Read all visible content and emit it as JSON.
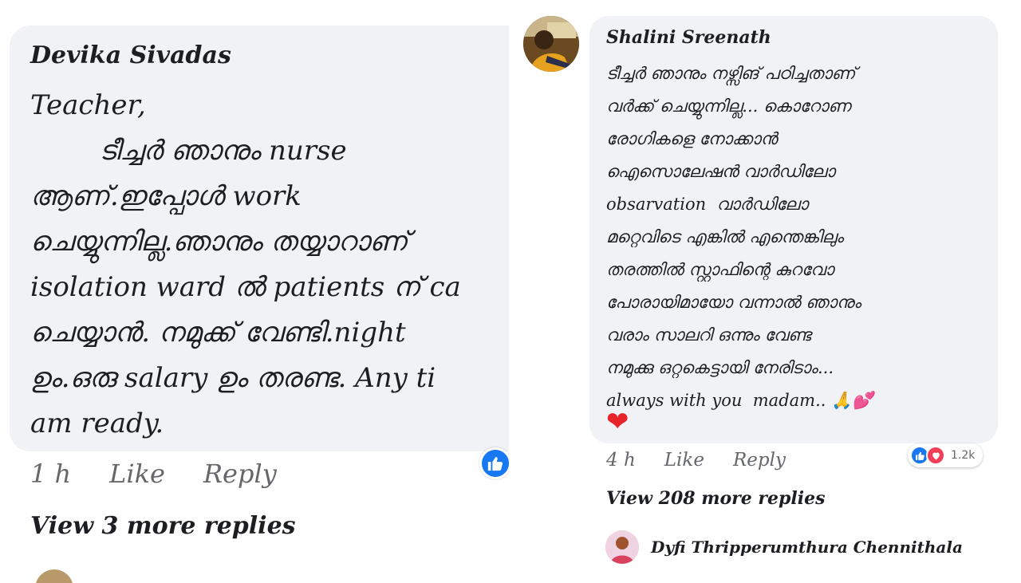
{
  "left_comment": {
    "author": "Devika Sivadas",
    "text": "Teacher,\n        ടീച്ചർ ഞാനും nurse\nആണ്.ഇപ്പോൾ work\nചെയ്യുന്നില്ല.ഞാനും തയ്യാറാണ്\nisolation ward ൽ patients ന് ca\nചെയ്യാൻ. നമുക്ക് വേണ്ടി.night\nഉം.ഒരു salary ഉം തരണ്ട. Any ti\nam ready.",
    "time": "1 h",
    "like_label": "Like",
    "reply_label": "Reply",
    "more_replies": "View 3 more replies",
    "reaction_icon": "like-icon"
  },
  "right_comment": {
    "author": "Shalini Sreenath",
    "text": "ടീച്ചർ ഞാനും നഴ്സിങ് പഠിച്ചതാണ്\nവർക്ക് ചെയ്യുന്നില്ല... കൊറോണ\nരോഗികളെ നോക്കാൻ\nഐസൊലേഷൻ വാർഡിലോ\nobsarvation  വാർഡിലോ\nമറ്റെവിടെ എങ്കിൽ എന്തെങ്കിലും\nതരത്തിൽ സ്റ്റാഫിന്റെ കുറവോ\nപോരായിമായോ വന്നാൽ ഞാനും\nവരാം സാലറി ഒന്നും വേണ്ട\nനമുക്കു ഒറ്റകെട്ടായി നേരിടാം...\nalways with you  madam.. 🙏💕",
    "emoji_heart": "❤",
    "time": "4 h",
    "like_label": "Like",
    "reply_label": "Reply",
    "reaction_count": "1.2k",
    "reaction_icons": [
      "like-icon",
      "love-icon"
    ],
    "more_replies": "View 208 more replies",
    "reply_preview_author": "Dyfi Thripperumthura Chennithala"
  },
  "colors": {
    "bubble": "#f0f2f5",
    "meta_text": "#65676b",
    "like_blue": "#1877f2",
    "love_red": "#f33e58"
  }
}
